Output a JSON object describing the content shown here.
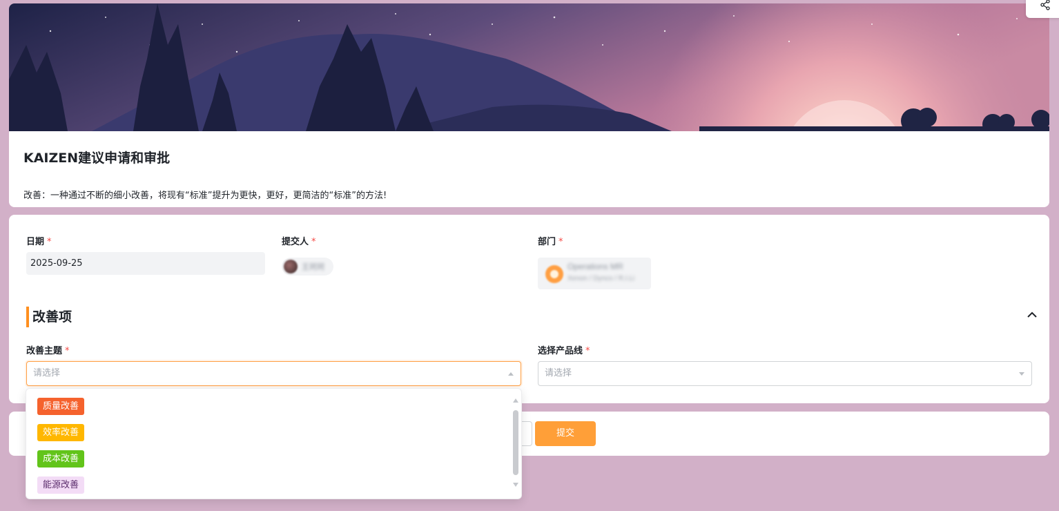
{
  "form": {
    "title": "KAIZEN建议申请和审批",
    "description": "改善：一种通过不断的细小改善，将现有“标准”提升为更快，更好，更简洁的“标准”的方法!"
  },
  "fields": {
    "date": {
      "label": "日期",
      "required_mark": "*",
      "value": "2025-09-25"
    },
    "submitter": {
      "label": "提交人",
      "required_mark": "*",
      "value": "王珂珂"
    },
    "department": {
      "label": "部门",
      "required_mark": "*",
      "name": "Operations MR",
      "path": "Xenon / Dynco / R.I.Li"
    }
  },
  "section": {
    "title": "改善项",
    "topic": {
      "label": "改善主题",
      "required_mark": "*",
      "placeholder": "请选择"
    },
    "product_line": {
      "label": "选择产品线",
      "required_mark": "*",
      "placeholder": "请选择"
    }
  },
  "dropdown": {
    "options": [
      {
        "label": "质量改善",
        "bg": "#f5622d",
        "fg": "#ffffff"
      },
      {
        "label": "效率改善",
        "bg": "#ffb700",
        "fg": "#ffffff"
      },
      {
        "label": "成本改善",
        "bg": "#62c41a",
        "fg": "#ffffff"
      },
      {
        "label": "能源改善",
        "bg": "#f3dcf6",
        "fg": "#5a2b6b"
      }
    ]
  },
  "actions": {
    "submit_label": "提交"
  },
  "colors": {
    "accent": "#ff9f38",
    "required": "#f54a45",
    "page_bg": "#d2b0c8"
  },
  "icons": {
    "share": "share-icon",
    "collapse": "chevron-up-icon"
  }
}
